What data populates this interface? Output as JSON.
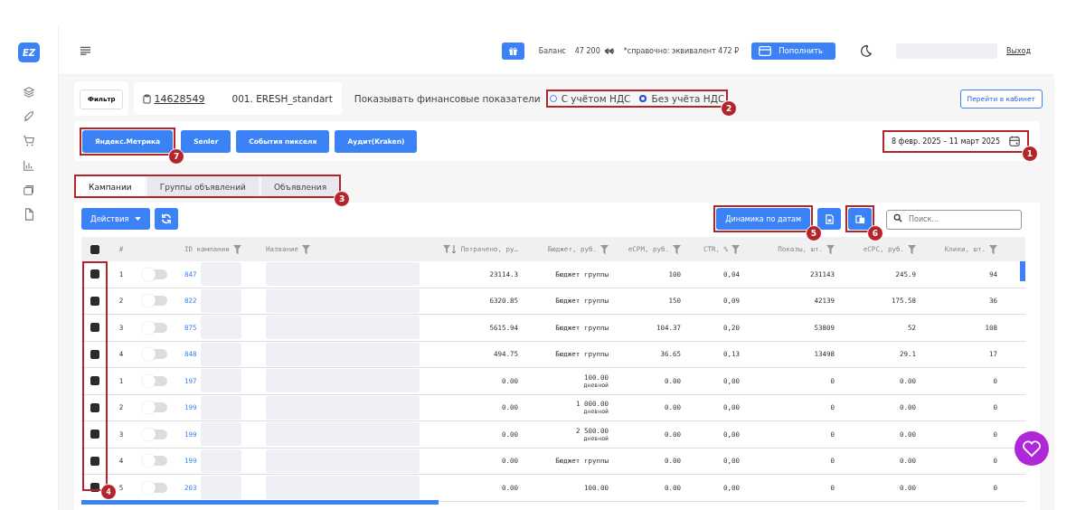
{
  "header": {
    "balance_label": "Баланс",
    "balance": "47 200",
    "reference": "*справочно: эквивалент 472 ₽",
    "topup": "Пополнить",
    "logout": "Выход"
  },
  "logo": "EZ",
  "filter_button": "Фильтр",
  "account": {
    "id": "14628549",
    "name": "001. ERESH_standart"
  },
  "vat": {
    "label": "Показывать финансовые показатели",
    "callout": "2",
    "options": [
      {
        "label": "С учётом НДС",
        "selected": false
      },
      {
        "label": "Без учёта НДС",
        "selected": true
      }
    ]
  },
  "cabinet_button": "Перейти в кабинет",
  "sources": [
    {
      "label": "Яндекс.Метрика",
      "callout": "7"
    },
    {
      "label": "Senler"
    },
    {
      "label": "События пикселя"
    },
    {
      "label": "Аудит(Kraken)"
    }
  ],
  "date_range": {
    "value": "8 февр. 2025 – 11 март 2025",
    "callout": "1"
  },
  "tabs": {
    "callout": "3",
    "items": [
      {
        "label": "Кампании",
        "selected": true
      },
      {
        "label": "Группы объявлений",
        "selected": false
      },
      {
        "label": "Объявления",
        "selected": false
      }
    ]
  },
  "toolbar": {
    "actions": "Действия",
    "dynamics": {
      "label": "Динамика по датам",
      "callout": "5"
    },
    "copy_callout": "6",
    "search_placeholder": "Поиск..."
  },
  "table": {
    "checkbox_callout": "4",
    "header_checked": true,
    "columns": [
      {
        "label": "#",
        "filter": false
      },
      {
        "label": "ID кампании",
        "filter": true
      },
      {
        "label": "Название",
        "filter": true
      },
      {
        "label": "Потрачено, ру…",
        "filter": true
      },
      {
        "label": "Бюджет, руб.",
        "filter": true
      },
      {
        "label": "eCPM, руб.",
        "filter": true
      },
      {
        "label": "CTR, %",
        "filter": true
      },
      {
        "label": "Показы, шт.",
        "filter": true
      },
      {
        "label": "eCPC, руб.",
        "filter": true
      },
      {
        "label": "Клики, шт.",
        "filter": true
      }
    ],
    "rows": [
      {
        "n": "1",
        "checked": true,
        "on": false,
        "id": "847",
        "spent": "23114.3",
        "budget": "Бюджет группы",
        "ecpm": "100",
        "ctr": "0,04",
        "shows": "231143",
        "ecpc": "245.9",
        "clicks": "94"
      },
      {
        "n": "2",
        "checked": true,
        "on": false,
        "id": "822",
        "spent": "6320.85",
        "budget": "Бюджет группы",
        "ecpm": "150",
        "ctr": "0,09",
        "shows": "42139",
        "ecpc": "175.58",
        "clicks": "36"
      },
      {
        "n": "3",
        "checked": true,
        "on": false,
        "id": "875",
        "spent": "5615.94",
        "budget": "Бюджет группы",
        "ecpm": "104.37",
        "ctr": "0,20",
        "shows": "53809",
        "ecpc": "52",
        "clicks": "108"
      },
      {
        "n": "4",
        "checked": true,
        "on": false,
        "id": "848",
        "spent": "494.75",
        "budget": "Бюджет группы",
        "ecpm": "36.65",
        "ctr": "0,13",
        "shows": "13498",
        "ecpc": "29.1",
        "clicks": "17"
      },
      {
        "n": "1",
        "checked": true,
        "on": false,
        "id": "197",
        "spent": "0.00",
        "budget": "100.00",
        "budget_note": "дневной",
        "ecpm": "0.00",
        "ctr": "0,00",
        "shows": "0",
        "ecpc": "0.00",
        "clicks": "0"
      },
      {
        "n": "2",
        "checked": true,
        "on": false,
        "id": "199",
        "spent": "0.00",
        "budget": "1 000.00",
        "budget_note": "дневной",
        "ecpm": "0.00",
        "ctr": "0,00",
        "shows": "0",
        "ecpc": "0.00",
        "clicks": "0"
      },
      {
        "n": "3",
        "checked": true,
        "on": false,
        "id": "199",
        "spent": "0.00",
        "budget": "2 500.00",
        "budget_note": "дневной",
        "ecpm": "0.00",
        "ctr": "0,00",
        "shows": "0",
        "ecpc": "0.00",
        "clicks": "0"
      },
      {
        "n": "4",
        "checked": true,
        "on": false,
        "id": "199",
        "spent": "0.00",
        "budget": "Бюджет группы",
        "ecpm": "0.00",
        "ctr": "0,00",
        "shows": "0",
        "ecpc": "0.00",
        "clicks": "0"
      },
      {
        "n": "5",
        "checked": true,
        "on": false,
        "id": "203",
        "spent": "0.00",
        "budget": "100.00",
        "ecpm": "0.00",
        "ctr": "0,00",
        "shows": "0",
        "ecpc": "0.00",
        "clicks": "0"
      }
    ]
  }
}
